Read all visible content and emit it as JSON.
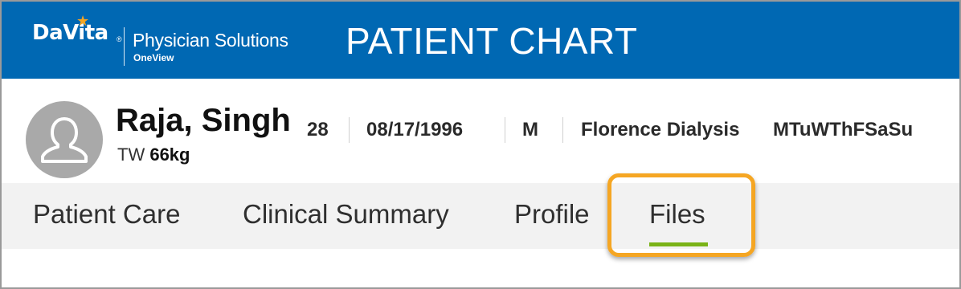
{
  "header": {
    "brand": "DaVita",
    "brand_registered": "®",
    "product_name": "Physician Solutions",
    "product_sub": "OneView",
    "page_title": "PATIENT CHART",
    "background_color": "#0068b3",
    "star_color": "#f5a623"
  },
  "patient": {
    "name": "Raja, Singh",
    "weight_label": "TW",
    "weight_value": "66kg",
    "age": "28",
    "dob": "08/17/1996",
    "sex": "M",
    "facility": "Florence Dialysis",
    "schedule": "MTuWThFSaSu",
    "avatar_icon": "user-silhouette-icon"
  },
  "tabs": [
    {
      "label": "Patient Care",
      "active": false
    },
    {
      "label": "Clinical Summary",
      "active": false
    },
    {
      "label": "Profile",
      "active": false
    },
    {
      "label": "Files",
      "active": true
    }
  ],
  "colors": {
    "active_tab_underline": "#7ab317",
    "highlight_outline": "#f5a623",
    "tab_bar_background": "#f2f2f2"
  }
}
